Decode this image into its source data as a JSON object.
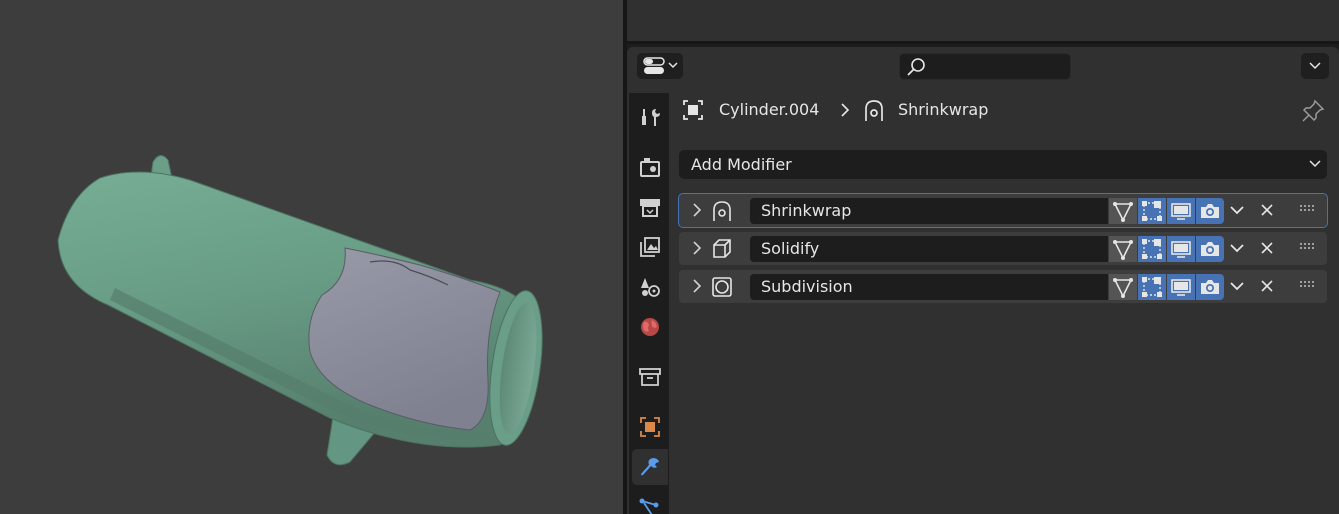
{
  "viewport": {
    "background": "#3d3d3d",
    "object_color": "#6a9e88",
    "patch_color": "#888a9a"
  },
  "header": {
    "editor_type_icon": "properties-editor-icon",
    "search": {
      "value": "",
      "placeholder": ""
    }
  },
  "tabs": [
    {
      "name": "tool-icon",
      "active": false
    },
    {
      "name": "render-icon",
      "active": false
    },
    {
      "name": "output-icon",
      "active": false
    },
    {
      "name": "view-layer-icon",
      "active": false
    },
    {
      "name": "scene-icon",
      "active": false
    },
    {
      "name": "world-icon",
      "active": false
    },
    {
      "name": "collection-icon",
      "active": false
    },
    {
      "name": "object-icon",
      "active": false
    },
    {
      "name": "modifier-wrench-icon",
      "active": true
    },
    {
      "name": "particles-icon",
      "active": false
    }
  ],
  "breadcrumb": {
    "object": "Cylinder.004",
    "modifier": "Shrinkwrap"
  },
  "add_modifier": {
    "label": "Add Modifier"
  },
  "modifiers": [
    {
      "name": "Shrinkwrap",
      "icon": "shrinkwrap-icon",
      "selected": true
    },
    {
      "name": "Solidify",
      "icon": "solidify-icon",
      "selected": false
    },
    {
      "name": "Subdivision",
      "icon": "subdivision-icon",
      "selected": false
    }
  ],
  "colors": {
    "accent": "#4772b3",
    "panel": "#303030",
    "field": "#1d1d1d",
    "row": "#3d3d3d"
  }
}
